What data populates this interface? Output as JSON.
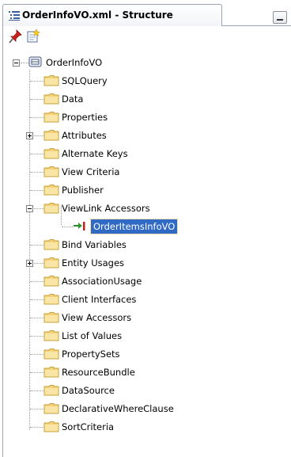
{
  "panel": {
    "title": "OrderInfoVO.xml - Structure"
  },
  "toolbar": {
    "pin_icon": "pin-icon",
    "new_icon": "new-item-icon"
  },
  "tree": {
    "root": {
      "label": "OrderInfoVO",
      "expanded": true,
      "icon": "view-object-icon"
    },
    "items": [
      {
        "label": "SQLQuery",
        "expandable": false
      },
      {
        "label": "Data",
        "expandable": false
      },
      {
        "label": "Properties",
        "expandable": false
      },
      {
        "label": "Attributes",
        "expandable": true,
        "expanded": false
      },
      {
        "label": "Alternate Keys",
        "expandable": false
      },
      {
        "label": "View Criteria",
        "expandable": false
      },
      {
        "label": "Publisher",
        "expandable": false
      },
      {
        "label": "ViewLink Accessors",
        "expandable": true,
        "expanded": true,
        "children": [
          {
            "label": "OrderItemsInfoVO",
            "selected": true,
            "icon": "view-link-accessor-icon"
          }
        ]
      },
      {
        "label": "Bind Variables",
        "expandable": false
      },
      {
        "label": "Entity Usages",
        "expandable": true,
        "expanded": false
      },
      {
        "label": "AssociationUsage",
        "expandable": false
      },
      {
        "label": "Client Interfaces",
        "expandable": false
      },
      {
        "label": "View Accessors",
        "expandable": false
      },
      {
        "label": "List of Values",
        "expandable": false
      },
      {
        "label": "PropertySets",
        "expandable": false
      },
      {
        "label": "ResourceBundle",
        "expandable": false
      },
      {
        "label": "DataSource",
        "expandable": false
      },
      {
        "label": "DeclarativeWhereClause",
        "expandable": false
      },
      {
        "label": "SortCriteria",
        "expandable": false
      }
    ]
  },
  "colors": {
    "selection": "#316ac5",
    "folder": "#f4d37a",
    "folder_edge": "#c9a13a"
  }
}
